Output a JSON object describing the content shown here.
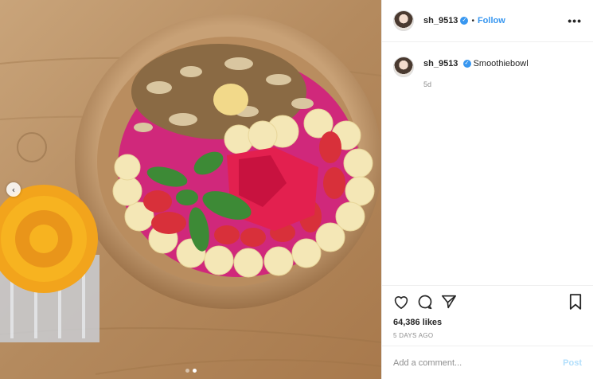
{
  "post": {
    "username": "sh_9513",
    "follow_label": "Follow",
    "separator": "•",
    "more_label": "•••",
    "caption_user": "sh_9513",
    "caption_text": "Smoothiebowl",
    "caption_age": "5d",
    "likes_text": "64,386 likes",
    "posted_text": "5 DAYS AGO",
    "comment_placeholder": "Add a comment...",
    "post_label": "Post",
    "verified_glyph": "✓",
    "prev_glyph": "‹"
  },
  "icons": {
    "like": "heart-icon",
    "comment": "comment-icon",
    "share": "share-icon",
    "save": "bookmark-icon",
    "verified": "verified-badge-icon",
    "prev": "chevron-left-icon"
  },
  "carousel": {
    "slides": 2,
    "active": 2
  },
  "colors": {
    "link": "#3897f0",
    "post_disabled": "#b2dffc",
    "text": "#262626",
    "muted": "#8e8e8e"
  }
}
